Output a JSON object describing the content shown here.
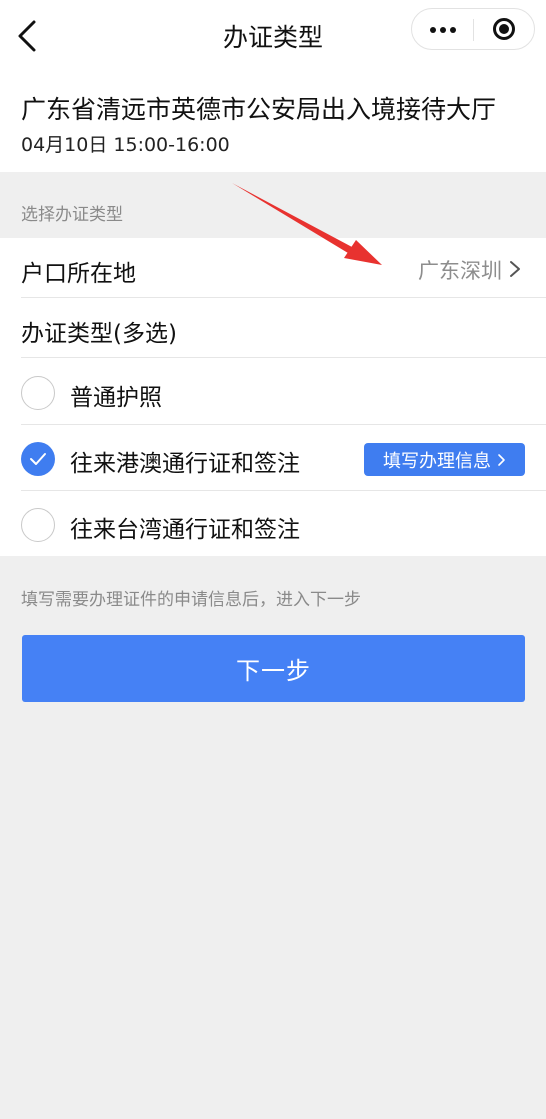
{
  "navbar": {
    "title": "办证类型",
    "back_icon": "chevron-left-icon",
    "more_icon": "more-dots-icon",
    "target_icon": "target-icon"
  },
  "venue": {
    "name": "广东省清远市英德市公安局出入境接待大厅",
    "time": "04月10日 15:00-16:00"
  },
  "section_label": "选择办证类型",
  "residence": {
    "label": "户口所在地",
    "value": "广东深圳"
  },
  "cert_type_title": "办证类型(多选)",
  "options": [
    {
      "label": "普通护照",
      "checked": false
    },
    {
      "label": "往来港澳通行证和签注",
      "checked": true,
      "action": "填写办理信息"
    },
    {
      "label": "往来台湾通行证和签注",
      "checked": false
    }
  ],
  "hint": "填写需要办理证件的申请信息后，进入下一步",
  "next_button": "下一步",
  "colors": {
    "accent": "#3f7df0",
    "primary_button": "#4581f5",
    "annotation_arrow": "#e8322f"
  }
}
